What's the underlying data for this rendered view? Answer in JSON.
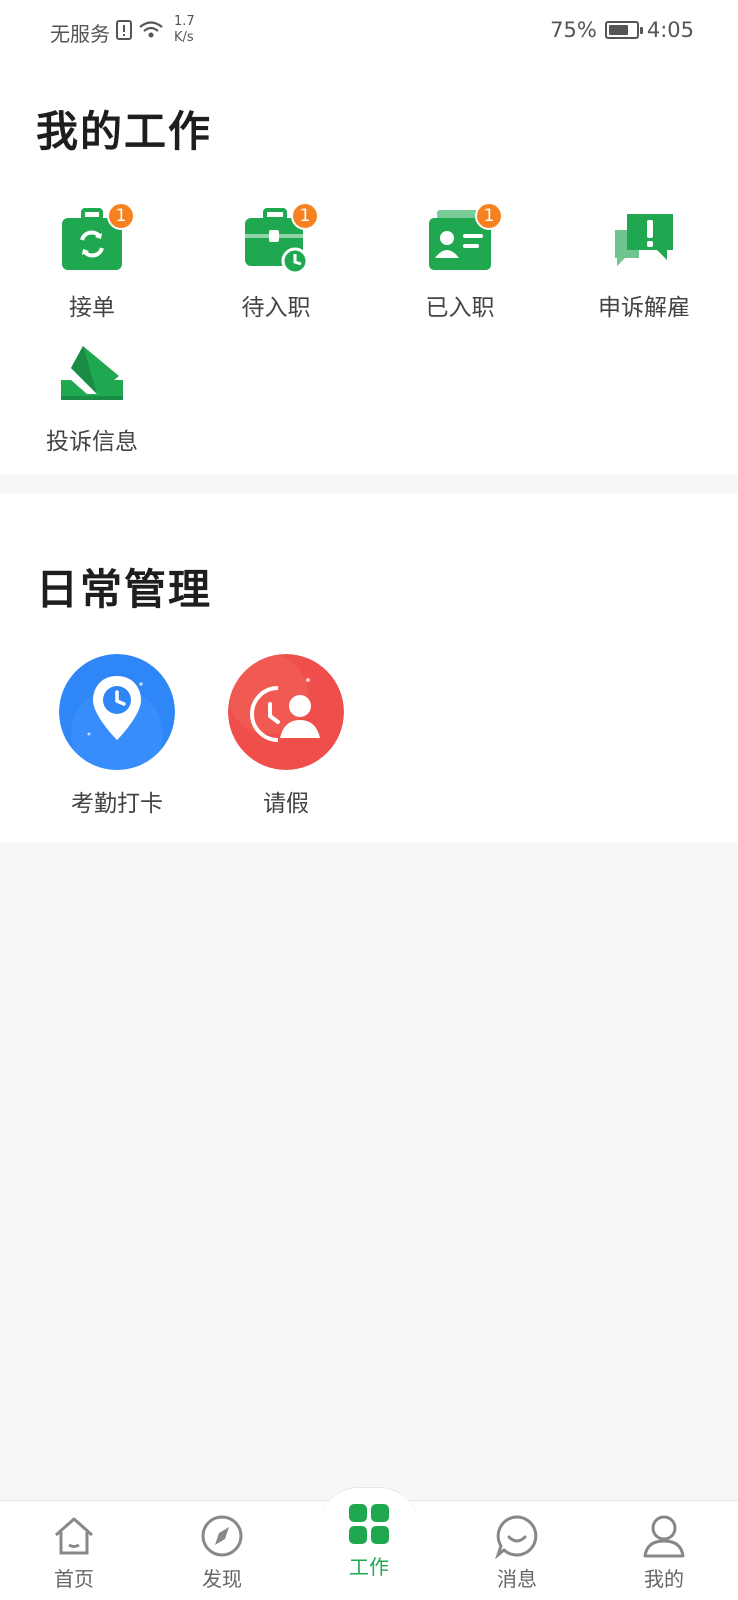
{
  "status_bar": {
    "carrier": "无服务",
    "speed_value": "1.7",
    "speed_unit": "K/s",
    "battery_percent": "75%",
    "battery_level": 0.75,
    "time": "4:05"
  },
  "work": {
    "title": "我的工作",
    "items": [
      {
        "label": "接单",
        "badge": "1",
        "icon": "briefcase-refresh-icon"
      },
      {
        "label": "待入职",
        "badge": "1",
        "icon": "briefcase-clock-icon"
      },
      {
        "label": "已入职",
        "badge": "1",
        "icon": "id-card-icon"
      },
      {
        "label": "申诉解雇",
        "badge": "",
        "icon": "chat-alert-icon"
      },
      {
        "label": "投诉信息",
        "badge": "",
        "icon": "envelope-tray-icon"
      }
    ]
  },
  "daily": {
    "title": "日常管理",
    "items": [
      {
        "label": "考勤打卡",
        "icon": "location-clock-icon",
        "color": "#2f86f6"
      },
      {
        "label": "请假",
        "icon": "clock-person-icon",
        "color": "#ef4e4a"
      }
    ]
  },
  "nav": {
    "items": [
      {
        "label": "首页",
        "icon": "home-icon"
      },
      {
        "label": "发现",
        "icon": "compass-icon"
      },
      {
        "label": "工作",
        "icon": "grid-icon",
        "active": true
      },
      {
        "label": "消息",
        "icon": "chat-smile-icon"
      },
      {
        "label": "我的",
        "icon": "user-icon"
      }
    ]
  },
  "colors": {
    "accent": "#20a851",
    "badge": "#f5821f",
    "background": "#f7f7f7"
  }
}
